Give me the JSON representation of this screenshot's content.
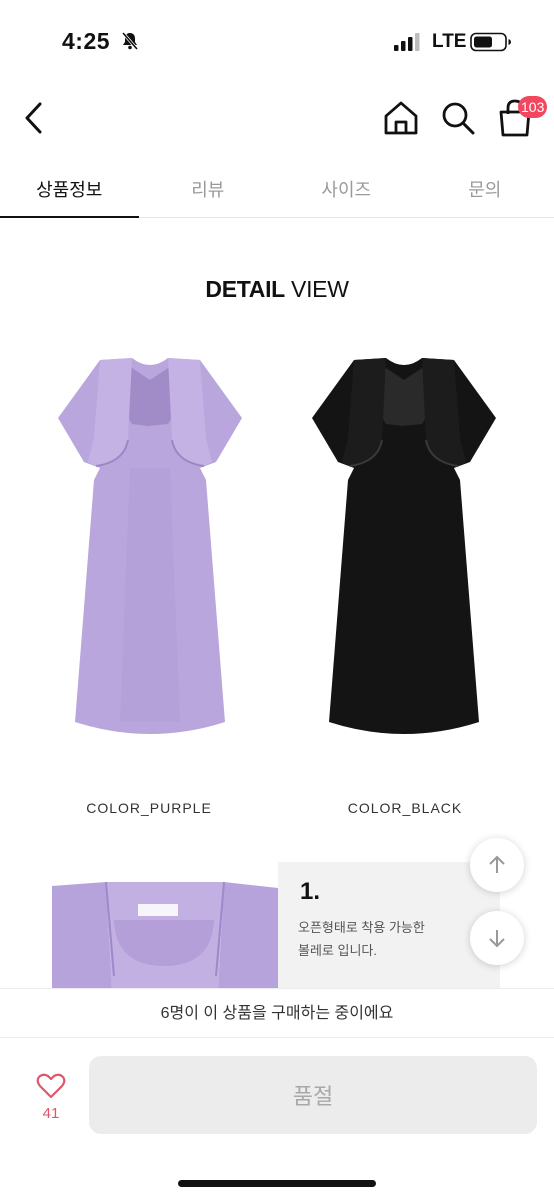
{
  "status_bar": {
    "time": "4:25",
    "network": "LTE"
  },
  "nav": {
    "cart_count": "103"
  },
  "tabs": [
    {
      "label": "상품정보",
      "active": true
    },
    {
      "label": "리뷰",
      "active": false
    },
    {
      "label": "사이즈",
      "active": false
    },
    {
      "label": "문의",
      "active": false
    }
  ],
  "detail": {
    "heading_bold": "DETAIL",
    "heading_rest": " VIEW",
    "colors": [
      {
        "label": "COLOR_PURPLE",
        "hex": "#b9a6dd"
      },
      {
        "label": "COLOR_BLACK",
        "hex": "#141414"
      }
    ],
    "point_number": "1.",
    "point_text_line1": "오픈형태로 착용 가능한",
    "point_text_line2": "볼레로 입니다."
  },
  "footer": {
    "buyers_text": "6명이 이 상품을 구매하는 중이에요",
    "like_count": "41",
    "soldout_label": "품절"
  },
  "colors": {
    "accent_red": "#f2475f",
    "like_pink": "#e0566b"
  }
}
